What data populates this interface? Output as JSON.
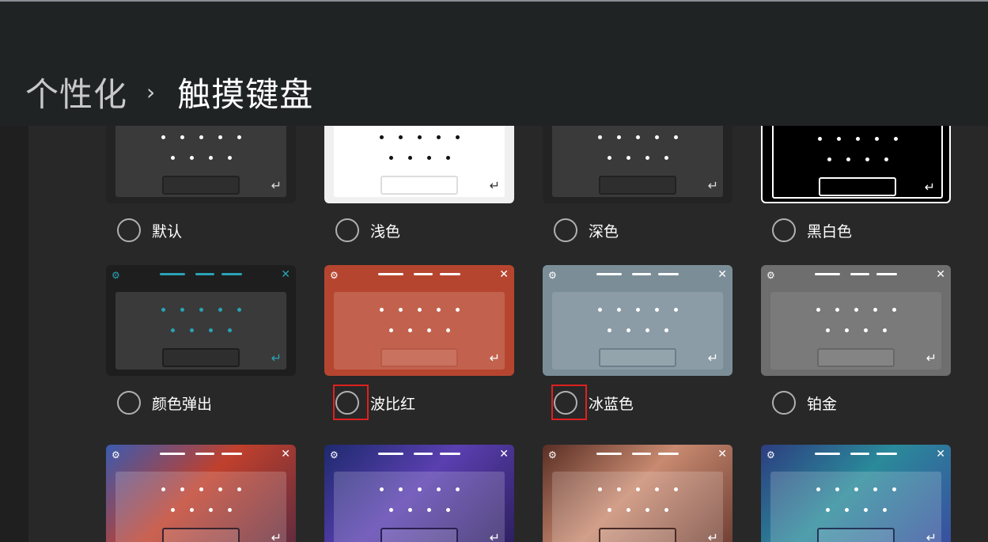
{
  "breadcrumb": {
    "parent": "个性化",
    "separator": "›",
    "current": "触摸键盘"
  },
  "icons": {
    "gear": "⚙",
    "close": "✕",
    "enter": "↵"
  },
  "themes": [
    {
      "id": "default",
      "label": "默认",
      "bg": "#232323",
      "panel": "#3a3a3a",
      "dot": "#ffffff",
      "space": "#2e2e2e",
      "space_border": "#222222",
      "enter_color": "#dddddd"
    },
    {
      "id": "light",
      "label": "浅色",
      "bg": "#f0f0f0",
      "panel": "#ffffff",
      "dot": "#111111",
      "space": "#ffffff",
      "space_border": "#dddddd",
      "enter_color": "#333333"
    },
    {
      "id": "dark",
      "label": "深色",
      "bg": "#232323",
      "panel": "#3a3a3a",
      "dot": "#ffffff",
      "space": "#2e2e2e",
      "space_border": "#222222",
      "enter_color": "#dddddd"
    },
    {
      "id": "hc",
      "label": "黑白色",
      "bg": "#000000",
      "panel": "#000000",
      "dot": "#ffffff",
      "space": "#000000",
      "space_border": "#ffffff",
      "enter_color": "#ffffff"
    },
    {
      "id": "accent",
      "label": "颜色弹出",
      "bg": "#1e1e1e",
      "panel": "#3a3a3a",
      "dot": "#29a3b5",
      "space": "#2e2e2e",
      "space_border": "#1e1e1e",
      "enter_color": "#29a3b5",
      "accent": "#29a3b5"
    },
    {
      "id": "red",
      "label": "波比红",
      "bg": "#b64530",
      "panel": "#c2624e",
      "dot": "#ffffff",
      "space": "#c8725f",
      "space_border": "#b85a47",
      "enter_color": "#ffffff"
    },
    {
      "id": "ice",
      "label": "冰蓝色",
      "bg": "#7b8e98",
      "panel": "#8b9ca6",
      "dot": "#ffffff",
      "space": "#94a4ad",
      "space_border": "#6c7e88",
      "enter_color": "#ffffff"
    },
    {
      "id": "platinum",
      "label": "铂金",
      "bg": "#6e6e6e",
      "panel": "#7a7a7a",
      "dot": "#ffffff",
      "space": "#848484",
      "space_border": "#676767",
      "enter_color": "#ffffff"
    },
    {
      "id": "img1",
      "label": "",
      "bg": "linear-gradient(135deg,#3b5bb0 0%,#c0402c 45%,#5a2a40 100%)",
      "panel": "rgba(255,255,255,0.18)",
      "dot": "#ffffff",
      "space": "rgba(255,255,255,0.10)",
      "space_border": "#3a2530",
      "enter_color": "#ffffff"
    },
    {
      "id": "img2",
      "label": "",
      "bg": "linear-gradient(135deg,#1e2a6e 0%,#5a3fb0 45%,#2a1d5a 100%)",
      "panel": "rgba(255,255,255,0.18)",
      "dot": "#ffffff",
      "space": "rgba(255,255,255,0.10)",
      "space_border": "#2a2050",
      "enter_color": "#ffffff"
    },
    {
      "id": "img3",
      "label": "",
      "bg": "linear-gradient(135deg,#5a2e25 0%,#c88a70 45%,#6a3a30 100%)",
      "panel": "rgba(255,255,255,0.18)",
      "dot": "#ffffff",
      "space": "rgba(255,255,255,0.10)",
      "space_border": "#4a2a25",
      "enter_color": "#ffffff"
    },
    {
      "id": "img4",
      "label": "",
      "bg": "linear-gradient(135deg,#2d3d80 0%,#2a8a9a 45%,#3a4aa0 100%)",
      "panel": "rgba(255,255,255,0.18)",
      "dot": "#ffffff",
      "space": "rgba(255,255,255,0.10)",
      "space_border": "#25355a",
      "enter_color": "#ffffff"
    }
  ],
  "highlighted": [
    "red",
    "ice"
  ],
  "highlight_color": "#e02020"
}
